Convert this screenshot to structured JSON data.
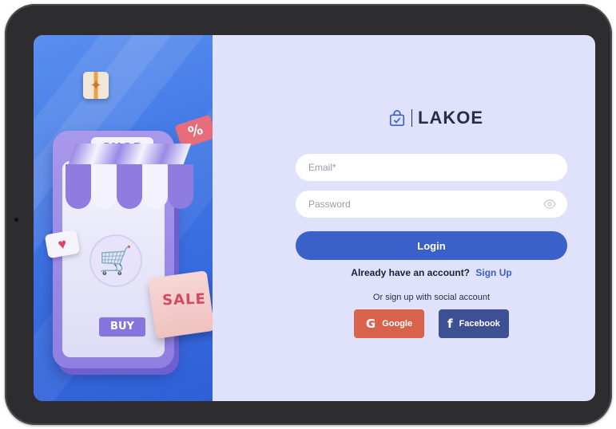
{
  "brand": {
    "name": "LAKOE",
    "icon": "shopping-bag-check-icon"
  },
  "illustration": {
    "shop_sign": "SHOP",
    "sale_tag": "SALE",
    "buy_label": "BUY",
    "discount": "%"
  },
  "form": {
    "email_placeholder": "Email*",
    "password_placeholder": "Password",
    "password_icon": "eye-icon",
    "login_label": "Login",
    "account_prompt": "Already have an account?",
    "signup_link": "Sign Up",
    "social_prompt": "Or sign up with social account"
  },
  "social": {
    "google": {
      "label": "Google",
      "icon": "google-icon",
      "color": "#d9634a"
    },
    "facebook": {
      "label": "Facebook",
      "icon": "facebook-icon",
      "color": "#3d5094"
    }
  },
  "theme": {
    "primary": "#3a60c9",
    "panel_bg": "#e0e1fb",
    "hero_bg": "#3f74e4"
  }
}
